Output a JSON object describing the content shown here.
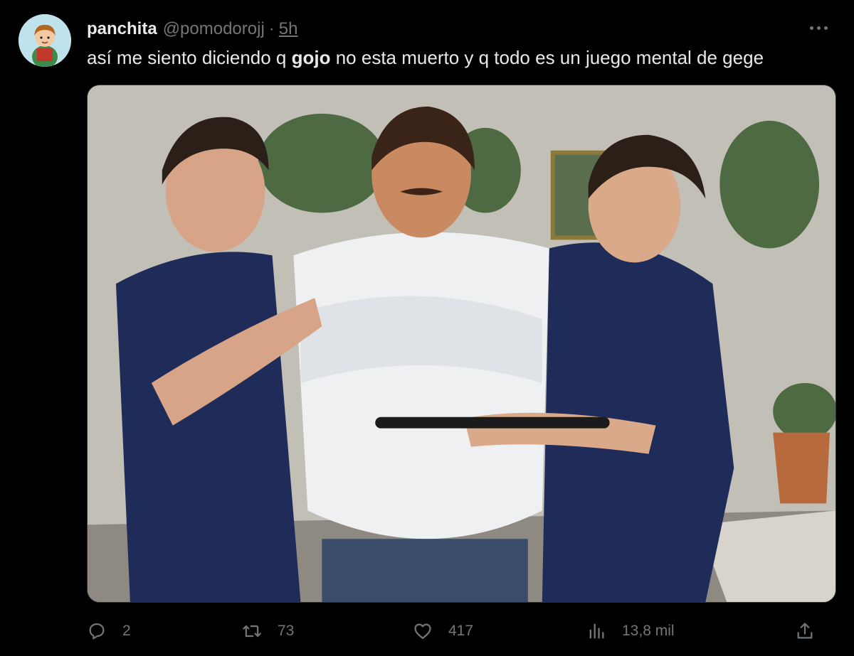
{
  "author": {
    "display_name": "panchita",
    "handle": "@pomodorojj",
    "separator": "·",
    "time": "5h",
    "avatar_icon": "cartoon-girl-avatar"
  },
  "tweet": {
    "text_before": "así me siento diciendo q ",
    "text_bold": "gojo",
    "text_after": " no esta muerto y q todo es un juego mental de gege"
  },
  "media": {
    "type": "image",
    "subject": "meme-photo"
  },
  "actions": {
    "reply_count": "2",
    "retweet_count": "73",
    "like_count": "417",
    "views_count": "13,8 mil"
  },
  "colors": {
    "background": "#000000",
    "primary_text": "#e7e9ea",
    "secondary_text": "#71767b",
    "border": "#2f3336"
  }
}
